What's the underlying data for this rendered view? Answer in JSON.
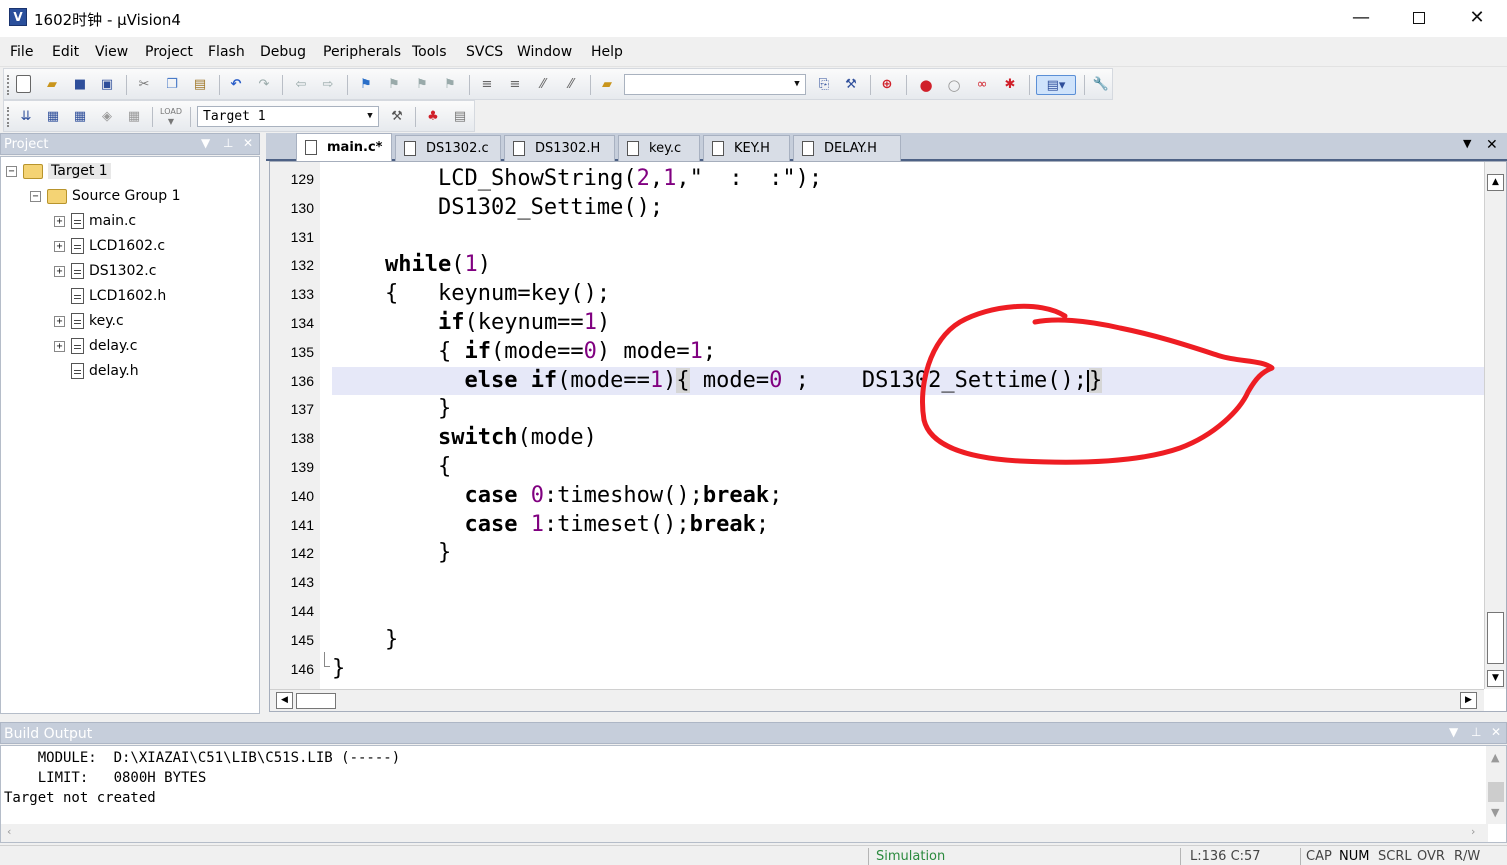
{
  "window": {
    "title": "1602时钟 - µVision4",
    "app_icon": "uvision-icon"
  },
  "menu": [
    "File",
    "Edit",
    "View",
    "Project",
    "Flash",
    "Debug",
    "Peripherals",
    "Tools",
    "SVCS",
    "Window",
    "Help"
  ],
  "toolbar2": {
    "target_select": "Target 1",
    "load_label": "LOAD"
  },
  "project": {
    "title": "Project",
    "tree": [
      {
        "label": "Target 1",
        "kind": "target",
        "level": 0,
        "expander": "−"
      },
      {
        "label": "Source Group 1",
        "kind": "folder",
        "level": 1,
        "expander": "−"
      },
      {
        "label": "main.c",
        "kind": "file",
        "level": 2,
        "expander": "+"
      },
      {
        "label": "LCD1602.c",
        "kind": "file",
        "level": 2,
        "expander": "+"
      },
      {
        "label": "DS1302.c",
        "kind": "file",
        "level": 2,
        "expander": "+"
      },
      {
        "label": "LCD1602.h",
        "kind": "file",
        "level": 2,
        "expander": ""
      },
      {
        "label": "key.c",
        "kind": "file",
        "level": 2,
        "expander": "+"
      },
      {
        "label": "delay.c",
        "kind": "file",
        "level": 2,
        "expander": "+"
      },
      {
        "label": "delay.h",
        "kind": "file",
        "level": 2,
        "expander": ""
      }
    ]
  },
  "editor": {
    "tabs": [
      "main.c*",
      "DS1302.c",
      "DS1302.H",
      "key.c",
      "KEY.H",
      "DELAY.H"
    ],
    "active_tab": 0,
    "current_line": 136,
    "lines": [
      {
        "n": "129",
        "code": "        LCD_ShowString(2,1,\"  :  :\");"
      },
      {
        "n": "130",
        "code": "        DS1302_Settime();"
      },
      {
        "n": "131",
        "code": ""
      },
      {
        "n": "132",
        "code": "    while(1)"
      },
      {
        "n": "133",
        "code": "    {   keynum=key();"
      },
      {
        "n": "134",
        "code": "        if(keynum==1)"
      },
      {
        "n": "135",
        "code": "        { if(mode==0) mode=1;"
      },
      {
        "n": "136",
        "code": "          else if(mode==1){ mode=0 ;    DS1302_Settime();}"
      },
      {
        "n": "137",
        "code": "        }"
      },
      {
        "n": "138",
        "code": "        switch(mode)"
      },
      {
        "n": "139",
        "code": "        {"
      },
      {
        "n": "140",
        "code": "          case 0:timeshow();break;"
      },
      {
        "n": "141",
        "code": "          case 1:timeset();break;"
      },
      {
        "n": "142",
        "code": "        }"
      },
      {
        "n": "143",
        "code": ""
      },
      {
        "n": "144",
        "code": ""
      },
      {
        "n": "145",
        "code": "    }"
      },
      {
        "n": "146",
        "code": "}"
      }
    ]
  },
  "build_output": {
    "title": "Build Output",
    "lines": [
      "    MODULE:  D:\\XIAZAI\\C51\\LIB\\C51S.LIB (-----)",
      "    LIMIT:   0800H BYTES",
      "Target not created"
    ]
  },
  "status": {
    "mode": "Simulation",
    "position": "L:136 C:57",
    "caps": "CAP",
    "num": "NUM",
    "scrl": "SCRL",
    "ovr": "OVR",
    "rw": "R/W"
  },
  "colors": {
    "number": "#800080",
    "current_line_bg": "#e6e8f8",
    "panel_header": "#c6cedb",
    "annotation_circle": "#ee1d23"
  }
}
